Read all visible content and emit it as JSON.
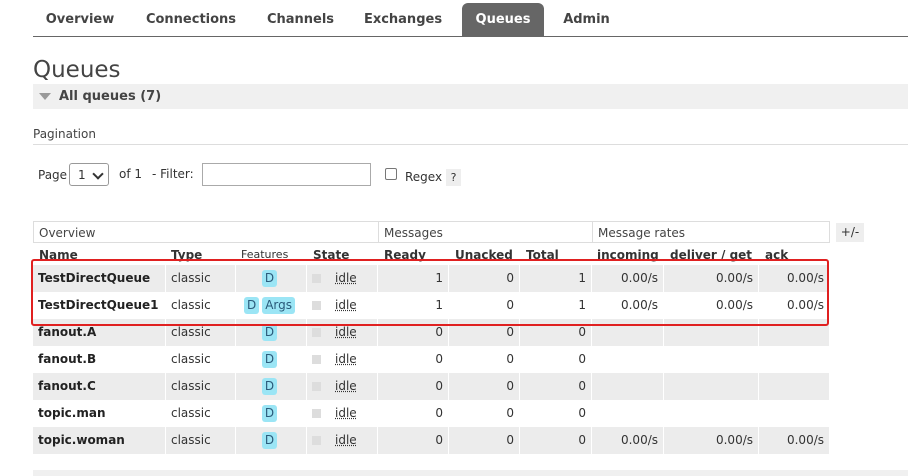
{
  "nav": {
    "tabs": [
      {
        "label": "Overview",
        "active": false
      },
      {
        "label": "Connections",
        "active": false
      },
      {
        "label": "Channels",
        "active": false
      },
      {
        "label": "Exchanges",
        "active": false
      },
      {
        "label": "Queues",
        "active": true
      },
      {
        "label": "Admin",
        "active": false
      }
    ]
  },
  "page": {
    "title": "Queues",
    "section": "All queues (7)",
    "pagination_label": "Pagination"
  },
  "pagination": {
    "page_label": "Page",
    "page_value": "1",
    "of_label": "of 1",
    "filter_label": "- Filter:",
    "filter_value": "",
    "regex_label": "Regex",
    "regex_checked": false,
    "help": "?"
  },
  "table": {
    "groups": [
      "Overview",
      "Messages",
      "Message rates"
    ],
    "toggle_label": "+/-",
    "headers": [
      "Name",
      "Type",
      "Features",
      "State",
      "Ready",
      "Unacked",
      "Total",
      "incoming",
      "deliver / get",
      "ack"
    ],
    "rows": [
      {
        "name": "TestDirectQueue",
        "type": "classic",
        "features": [
          "D"
        ],
        "state": "idle",
        "ready": "1",
        "unacked": "0",
        "total": "1",
        "incoming": "0.00/s",
        "deliver_get": "0.00/s",
        "ack": "0.00/s"
      },
      {
        "name": "TestDirectQueue1",
        "type": "classic",
        "features": [
          "D",
          "Args"
        ],
        "state": "idle",
        "ready": "1",
        "unacked": "0",
        "total": "1",
        "incoming": "0.00/s",
        "deliver_get": "0.00/s",
        "ack": "0.00/s"
      },
      {
        "name": "fanout.A",
        "type": "classic",
        "features": [
          "D"
        ],
        "state": "idle",
        "ready": "0",
        "unacked": "0",
        "total": "0",
        "incoming": "",
        "deliver_get": "",
        "ack": ""
      },
      {
        "name": "fanout.B",
        "type": "classic",
        "features": [
          "D"
        ],
        "state": "idle",
        "ready": "0",
        "unacked": "0",
        "total": "0",
        "incoming": "",
        "deliver_get": "",
        "ack": ""
      },
      {
        "name": "fanout.C",
        "type": "classic",
        "features": [
          "D"
        ],
        "state": "idle",
        "ready": "0",
        "unacked": "0",
        "total": "0",
        "incoming": "",
        "deliver_get": "",
        "ack": ""
      },
      {
        "name": "topic.man",
        "type": "classic",
        "features": [
          "D"
        ],
        "state": "idle",
        "ready": "0",
        "unacked": "0",
        "total": "0",
        "incoming": "",
        "deliver_get": "",
        "ack": ""
      },
      {
        "name": "topic.woman",
        "type": "classic",
        "features": [
          "D"
        ],
        "state": "idle",
        "ready": "0",
        "unacked": "0",
        "total": "0",
        "incoming": "0.00/s",
        "deliver_get": "0.00/s",
        "ack": "0.00/s"
      }
    ]
  },
  "colors": {
    "row_odd": "#ececec",
    "row_even": "#ffffff",
    "badge": "#9be5f5",
    "highlight": "#e02020",
    "active_tab": "#666666"
  }
}
